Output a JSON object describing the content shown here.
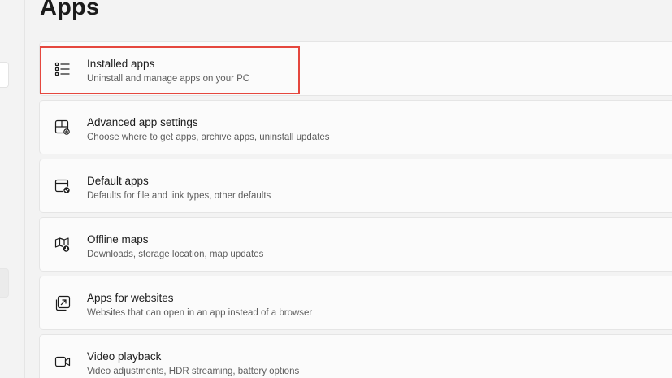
{
  "page": {
    "title": "Apps"
  },
  "items": [
    {
      "label": "Installed apps",
      "description": "Uninstall and manage apps on your PC",
      "icon": "list-icon"
    },
    {
      "label": "Advanced app settings",
      "description": "Choose where to get apps, archive apps, uninstall updates",
      "icon": "app-settings-icon"
    },
    {
      "label": "Default apps",
      "description": "Defaults for file and link types, other defaults",
      "icon": "default-apps-icon"
    },
    {
      "label": "Offline maps",
      "description": "Downloads, storage location, map updates",
      "icon": "offline-map-icon"
    },
    {
      "label": "Apps for websites",
      "description": "Websites that can open in an app instead of a browser",
      "icon": "open-external-icon"
    },
    {
      "label": "Video playback",
      "description": "Video adjustments, HDR streaming, battery options",
      "icon": "video-camera-icon"
    }
  ],
  "colors": {
    "background": "#f3f3f3",
    "card": "#fbfbfb",
    "highlight": "#e5473e"
  }
}
